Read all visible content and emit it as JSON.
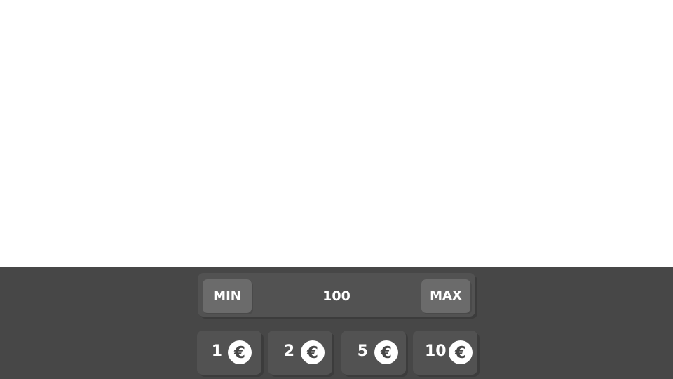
{
  "bet_panel": {
    "min_label": "MIN",
    "max_label": "MAX",
    "amount": "100",
    "chips": [
      {
        "value": "1",
        "currency_symbol": "€",
        "icon": "euro-coin-icon"
      },
      {
        "value": "2",
        "currency_symbol": "€",
        "icon": "euro-coin-icon"
      },
      {
        "value": "5",
        "currency_symbol": "€",
        "icon": "euro-coin-icon"
      },
      {
        "value": "10",
        "currency_symbol": "€",
        "icon": "euro-coin-icon"
      }
    ]
  },
  "colors": {
    "panel_background": "#474747",
    "bar_background": "#525252",
    "limit_button": "#6b6b6b",
    "text": "#ffffff"
  }
}
